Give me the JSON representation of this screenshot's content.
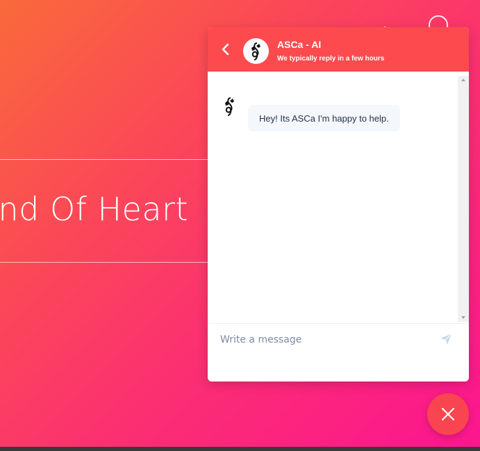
{
  "page": {
    "hero_heading": "und Of Heart"
  },
  "chat": {
    "title": "ASCa - AI",
    "subtitle": "We typically reply in a few hours",
    "messages": [
      {
        "sender": "bot",
        "text": "Hey! Its ASCa I'm happy to help."
      }
    ],
    "composer": {
      "placeholder": "Write a message",
      "value": ""
    },
    "icons": {
      "back": "chevron-left-icon",
      "avatar": "treble-clef-logo-icon",
      "send": "paper-plane-icon",
      "close": "close-icon"
    }
  },
  "colors": {
    "header": "#fd4a4f",
    "close_button": "#f9454f",
    "bubble": "#f4f7fb",
    "gradient_start": "#f96a3a",
    "gradient_end": "#fc1590"
  }
}
